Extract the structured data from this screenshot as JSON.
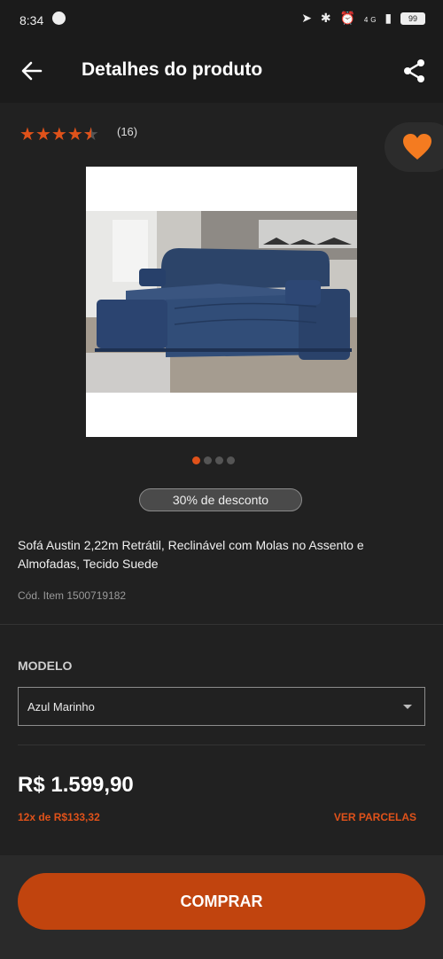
{
  "status_bar": {
    "time": "8:34",
    "battery": "99",
    "network": "4G"
  },
  "header": {
    "title": "Detalhes do produto"
  },
  "rating": {
    "stars": 4.5,
    "count_text": "(16)"
  },
  "product": {
    "image_icon": "sofa-image",
    "carousel": {
      "total": 4,
      "active": 1
    },
    "discount_badge": "30% de desconto",
    "name": "Sofá Austin 2,22m Retrátil, Reclinável com Molas no Assento e Almofadas, Tecido Suede",
    "code": "Cód. Item 1500719182"
  },
  "model": {
    "label": "MODELO",
    "selected": "Azul Marinho"
  },
  "pricing": {
    "price": "R$ 1.599,90",
    "installments": "12x de R$133,32",
    "installments_link": "VER PARCELAS"
  },
  "actions": {
    "buy_label": "COMPRAR"
  },
  "colors": {
    "accent": "#e0521a",
    "button": "#c1440e",
    "background": "#212121",
    "favorite": "#f47b20"
  }
}
